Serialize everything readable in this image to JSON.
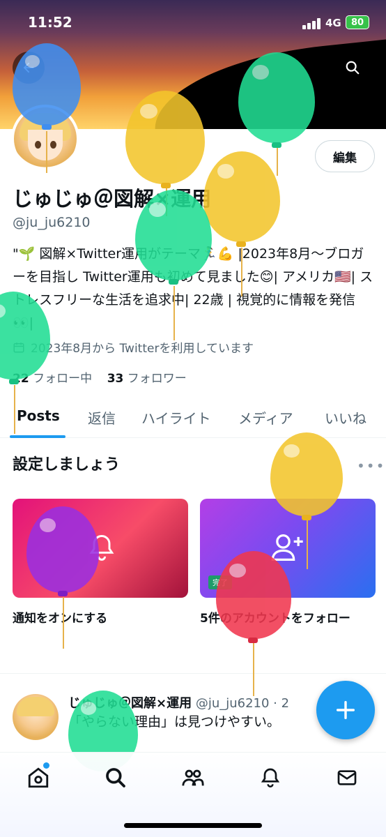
{
  "status_bar": {
    "time": "11:52",
    "network": "4G",
    "battery": "80"
  },
  "profile": {
    "edit_label": "編集",
    "name": "じゅじゅ＠図解×運用",
    "handle": "@ju_ju6210",
    "bio": "\"🌱 図解×Twitter運用がテーマ🏃‍♀️💪 |2023年8月〜ブロガーを目指し Twitter運用も初めて見ました😊| アメリカ🇺🇸| ストレスフリーな生活を追求中| 22歳 | 視覚的に情報を発信👀|",
    "joined": "2023年8月から Twitterを利用しています",
    "following_count": "22",
    "following_label": "フォロー中",
    "followers_count": "33",
    "followers_label": "フォロワー"
  },
  "tabs": [
    "Posts",
    "返信",
    "ハイライト",
    "メディア",
    "いいね"
  ],
  "setup": {
    "title": "設定しましょう",
    "cards": [
      {
        "label": "通知をオンにする"
      },
      {
        "label": "5件のアカウントをフォロー",
        "badge": "完了"
      }
    ]
  },
  "post": {
    "name": "じゅじゅ＠図解×運用",
    "handle": "@ju_ju6210 · 2",
    "text": "「やらない理由」は見つけやすい。"
  },
  "icons": {
    "back": "back-arrow-icon",
    "search": "search-icon",
    "calendar": "calendar-icon",
    "bell": "bell-icon",
    "add_user": "add-user-icon",
    "compose": "plus-icon",
    "home": "home-icon",
    "communities": "people-icon",
    "notifications": "bell-icon",
    "messages": "mail-icon"
  },
  "colors": {
    "accent": "#1d9bf0",
    "text": "#0f1419",
    "muted": "#536471"
  }
}
